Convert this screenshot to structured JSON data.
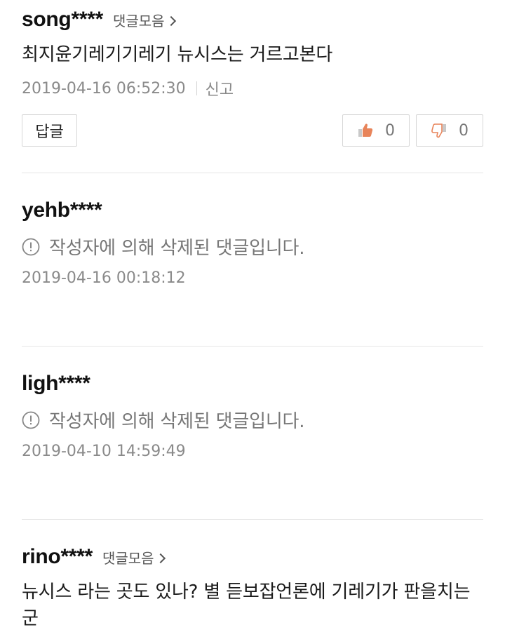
{
  "comments": [
    {
      "username": "song****",
      "collect_label": "댓글모음",
      "text": "최지윤기레기기레기 뉴시스는 거르고본다",
      "timestamp": "2019-04-16 06:52:30",
      "report_label": "신고",
      "reply_label": "답글",
      "likes": "0",
      "dislikes": "0"
    },
    {
      "username": "yehb****",
      "deleted_text": "작성자에 의해 삭제된 댓글입니다.",
      "timestamp": "2019-04-16 00:18:12"
    },
    {
      "username": "ligh****",
      "deleted_text": "작성자에 의해 삭제된 댓글입니다.",
      "timestamp": "2019-04-10 14:59:49"
    },
    {
      "username": "rino****",
      "collect_label": "댓글모음",
      "text": "뉴시스 라는 곳도 있나? 별 듣보잡언론에 기레기가 판을치는군"
    }
  ],
  "colors": {
    "like_icon": "#e8845a",
    "dislike_icon": "#e8845a",
    "divider": "#e6e6e6",
    "muted_text": "#8a8a8a"
  }
}
